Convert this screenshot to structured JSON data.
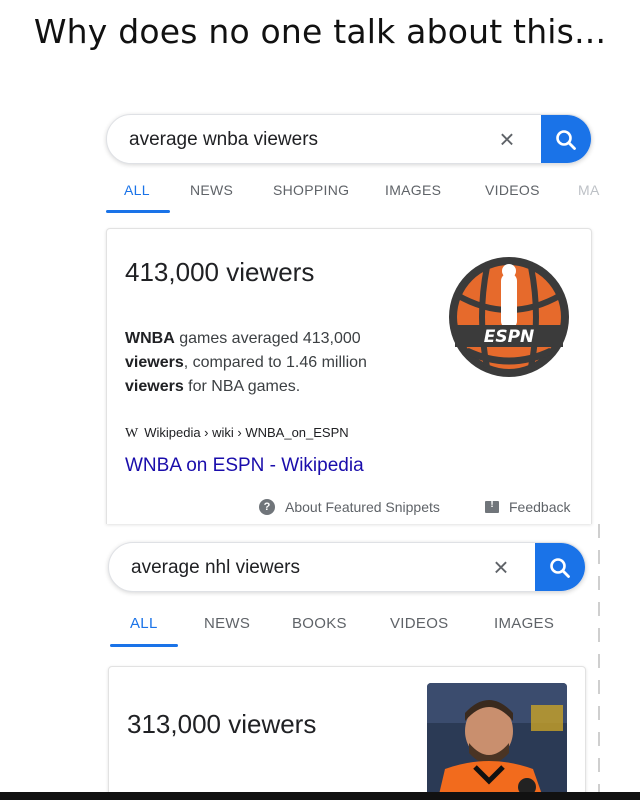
{
  "caption": "Why does no one talk about this...",
  "colors": {
    "accent": "#1a73e8",
    "link": "#1a0dab"
  },
  "search1": {
    "query": "average wnba viewers",
    "clear_icon": "close-icon",
    "search_icon": "search-icon",
    "tabs": [
      "ALL",
      "NEWS",
      "SHOPPING",
      "IMAGES",
      "VIDEOS",
      "MA"
    ],
    "active_tab": "ALL"
  },
  "result1": {
    "answer": "413,000 viewers",
    "snippet_line1_bold": "WNBA",
    "snippet_line1_rest": " games averaged 413,000",
    "snippet_line2_bold": "viewers",
    "snippet_line2_rest": ", compared to 1.46 million",
    "snippet_line3_bold": "viewers",
    "snippet_line3_rest": " for NBA games.",
    "source_logo": "W",
    "source_path": "Wikipedia › wiki › WNBA_on_ESPN",
    "link_title": "WNBA on ESPN - Wikipedia",
    "logo_text": "ESPN",
    "about_label": "About Featured Snippets",
    "feedback_label": "Feedback"
  },
  "search2": {
    "query": "average nhl viewers",
    "clear_icon": "close-icon",
    "search_icon": "search-icon",
    "tabs": [
      "ALL",
      "NEWS",
      "BOOKS",
      "VIDEOS",
      "IMAGES"
    ],
    "active_tab": "ALL"
  },
  "result2": {
    "answer": "313,000 viewers"
  }
}
